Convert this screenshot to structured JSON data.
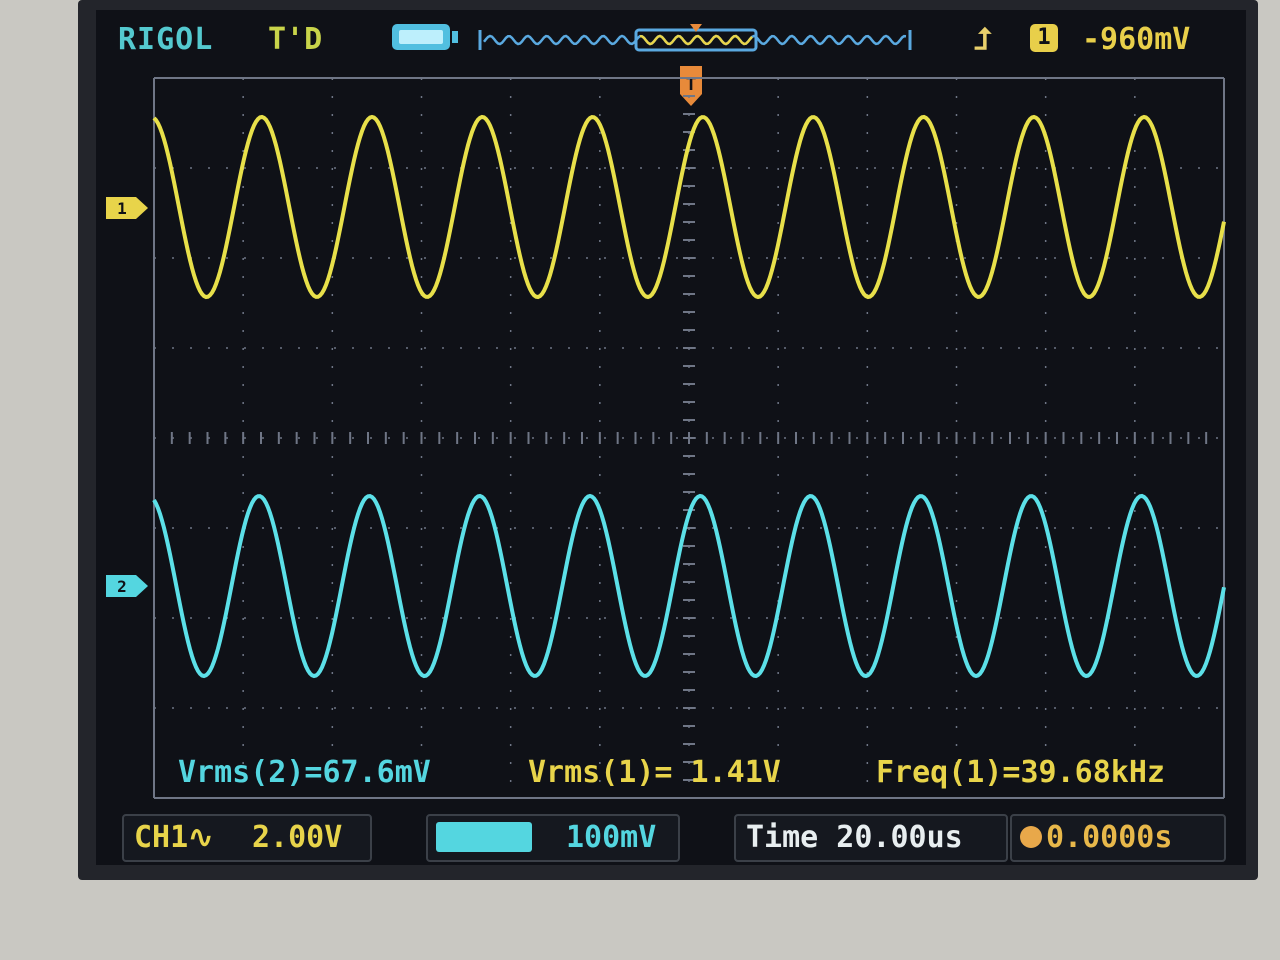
{
  "header": {
    "brand": "RIGOL",
    "status": "T'D",
    "trigger_source": "1",
    "trigger_level": "-960mV"
  },
  "markers": {
    "trigger": "T",
    "ch1": "1",
    "ch2": "2"
  },
  "measurements": {
    "m1": "Vrms(2)=67.6mV",
    "m2": "Vrms(1)= 1.41V",
    "m3": "Freq(1)=39.68kHz"
  },
  "status_bar": {
    "ch1_label": "CH1∿",
    "ch1_scale": "2.00V",
    "ch2_scale": "100mV",
    "time_label": "Time 20.00us",
    "trigger_offset": "0.0000s"
  },
  "colors": {
    "ch1": "#e8e04a",
    "ch2": "#5ce0e8",
    "background": "#0f1117",
    "grid": "#6f7686",
    "trigger": "#e88a3a"
  },
  "icons": {
    "battery": "memory-depth-icon",
    "trigger_edge": "rising-edge-icon",
    "trigger_marker": "trigger-position-icon"
  },
  "waveforms": {
    "cycles_shown": 9.7,
    "ch1_amplitude_div": 2.0,
    "ch2_amplitude_div": 2.0
  }
}
